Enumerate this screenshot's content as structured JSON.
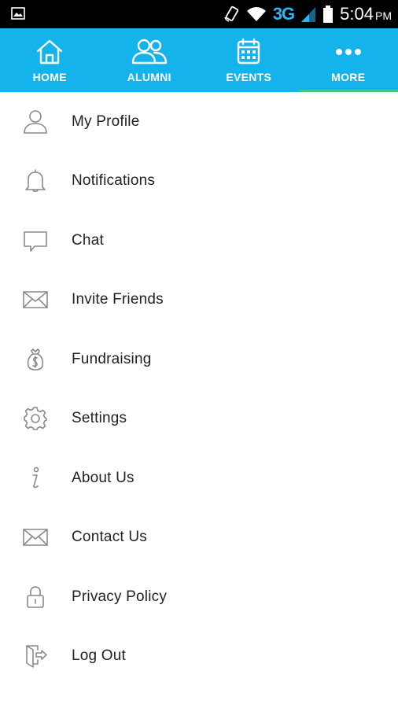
{
  "status_bar": {
    "network": "3G",
    "time": "5:04",
    "ampm": "PM"
  },
  "tabs": [
    {
      "label": "HOME",
      "icon": "home-icon",
      "active": false
    },
    {
      "label": "ALUMNI",
      "icon": "people-icon",
      "active": false
    },
    {
      "label": "EVENTS",
      "icon": "calendar-icon",
      "active": false
    },
    {
      "label": "MORE",
      "icon": "more-dots-icon",
      "active": true
    }
  ],
  "menu": [
    {
      "label": "My Profile",
      "icon": "profile-icon"
    },
    {
      "label": "Notifications",
      "icon": "bell-icon"
    },
    {
      "label": "Chat",
      "icon": "chat-icon"
    },
    {
      "label": "Invite Friends",
      "icon": "envelope-icon"
    },
    {
      "label": "Fundraising",
      "icon": "fundraising-icon"
    },
    {
      "label": "Settings",
      "icon": "gear-icon"
    },
    {
      "label": "About Us",
      "icon": "info-icon"
    },
    {
      "label": "Contact Us",
      "icon": "envelope-icon"
    },
    {
      "label": "Privacy Policy",
      "icon": "lock-icon"
    },
    {
      "label": "Log Out",
      "icon": "logout-icon"
    }
  ],
  "colors": {
    "tab_bar": "#14b3ec",
    "active_indicator": "#3cc68a",
    "status_bar": "#000000"
  }
}
